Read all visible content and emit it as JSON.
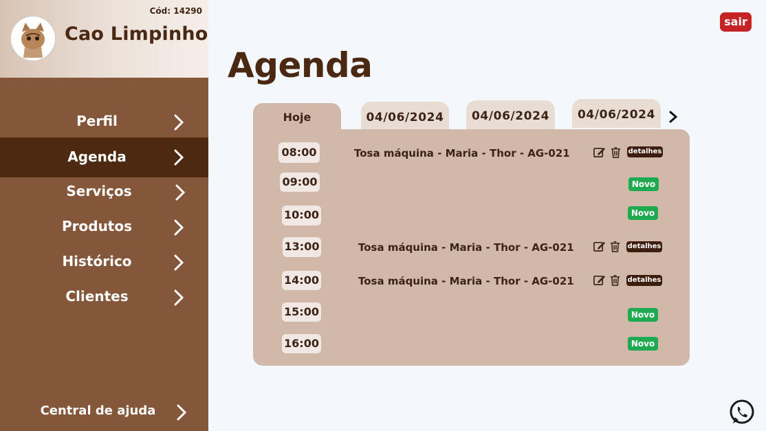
{
  "brand": {
    "code": "Cód: 14290",
    "name": "Cao Limpinho",
    "logo_icon": "cat-avatar-icon"
  },
  "sidebar": {
    "items": [
      {
        "label": "Perfil",
        "icon": "chevron-right-icon"
      },
      {
        "label": "Agenda",
        "icon": "chevron-right-icon",
        "active": true
      },
      {
        "label": "Serviços",
        "icon": "chevron-right-icon"
      },
      {
        "label": "Produtos",
        "icon": "chevron-right-icon"
      },
      {
        "label": "Histórico",
        "icon": "chevron-right-icon"
      },
      {
        "label": "Clientes",
        "icon": "chevron-right-icon"
      }
    ],
    "help": {
      "label": "Central de ajuda",
      "icon": "chevron-right-icon"
    }
  },
  "header": {
    "logout_label": "sair"
  },
  "main": {
    "title": "Agenda",
    "tabs": [
      {
        "label": "Hoje",
        "active": true
      },
      {
        "label": "04/06/2024"
      },
      {
        "label": "04/06/2024"
      },
      {
        "label": "04/06/2024"
      }
    ],
    "next_icon": "chevron-right-icon",
    "slots": [
      {
        "time": "08:00",
        "appointment": "Tosa máquina - Maria - Thor - AG-021",
        "actions": [
          "edit-icon",
          "trash-icon"
        ],
        "details_label": "detalhes"
      },
      {
        "time": "09:00",
        "new_label": "Novo"
      },
      {
        "time": "10:00",
        "new_label": "Novo"
      },
      {
        "time": "13:00",
        "appointment": "Tosa máquina - Maria - Thor - AG-021",
        "actions": [
          "edit-icon",
          "trash-icon"
        ],
        "details_label": "detalhes"
      },
      {
        "time": "14:00",
        "appointment": "Tosa máquina - Maria - Thor - AG-021",
        "actions": [
          "edit-icon",
          "trash-icon"
        ],
        "details_label": "detalhes"
      },
      {
        "time": "15:00",
        "new_label": "Novo"
      },
      {
        "time": "16:00",
        "new_label": "Novo"
      }
    ]
  },
  "whatsapp_icon": "whatsapp-icon",
  "colors": {
    "sidebar": "#84563a",
    "sidebar_active": "#4e2911",
    "panel": "#d0b9a8",
    "logout": "#c62326",
    "new": "#1faa52",
    "details": "#3d1d0d"
  }
}
